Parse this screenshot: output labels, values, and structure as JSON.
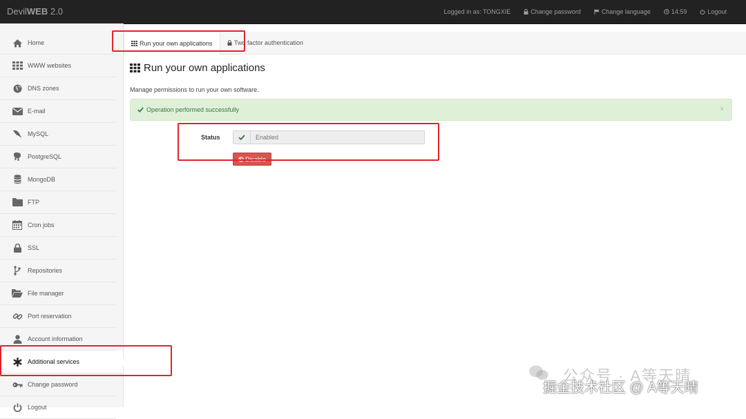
{
  "app": {
    "brand_prefix": "Devil",
    "brand_bold": "WEB",
    "brand_version": "2.0"
  },
  "topnav": {
    "logged_in": "Logged in as: TONGXIE",
    "change_password": "Change password",
    "change_language": "Change language",
    "time": "14:59",
    "logout": "Logout"
  },
  "sidebar": {
    "items": [
      {
        "label": "Home",
        "icon": "home-icon"
      },
      {
        "label": "WWW websites",
        "icon": "grid-icon"
      },
      {
        "label": "DNS zones",
        "icon": "globe-icon"
      },
      {
        "label": "E-mail",
        "icon": "envelope-icon"
      },
      {
        "label": "MySQL",
        "icon": "dolphin-icon"
      },
      {
        "label": "PostgreSQL",
        "icon": "elephant-icon"
      },
      {
        "label": "MongoDB",
        "icon": "database-icon"
      },
      {
        "label": "FTP",
        "icon": "folder-icon"
      },
      {
        "label": "Cron jobs",
        "icon": "calendar-icon"
      },
      {
        "label": "SSL",
        "icon": "lock-icon"
      },
      {
        "label": "Repositories",
        "icon": "branch-icon"
      },
      {
        "label": "File manager",
        "icon": "folder-open-icon"
      },
      {
        "label": "Port reservation",
        "icon": "link-icon"
      },
      {
        "label": "Account information",
        "icon": "user-icon"
      },
      {
        "label": "Additional services",
        "icon": "asterisk-icon"
      },
      {
        "label": "Change password",
        "icon": "key-icon"
      },
      {
        "label": "Logout",
        "icon": "power-icon"
      }
    ],
    "active_index": 14
  },
  "tabs": {
    "run_apps": "Run your own applications",
    "two_factor": "Two factor authentication"
  },
  "main": {
    "title": "Run your own applications",
    "subtitle": "Manage permissions to run your own software.",
    "alert": "Operation performed successfully",
    "alert_close": "×",
    "status_label": "Status",
    "status_value": "Enabled",
    "disable_button": "Disable"
  },
  "watermark": {
    "line1": "公众号 · A等天晴",
    "line2": "掘金技术社区 @ A等天晴"
  },
  "colors": {
    "navbar": "#222222",
    "alert_bg": "#dff0d8",
    "alert_text": "#3c763d",
    "danger": "#d9534f",
    "annotation": "#e0232b"
  }
}
